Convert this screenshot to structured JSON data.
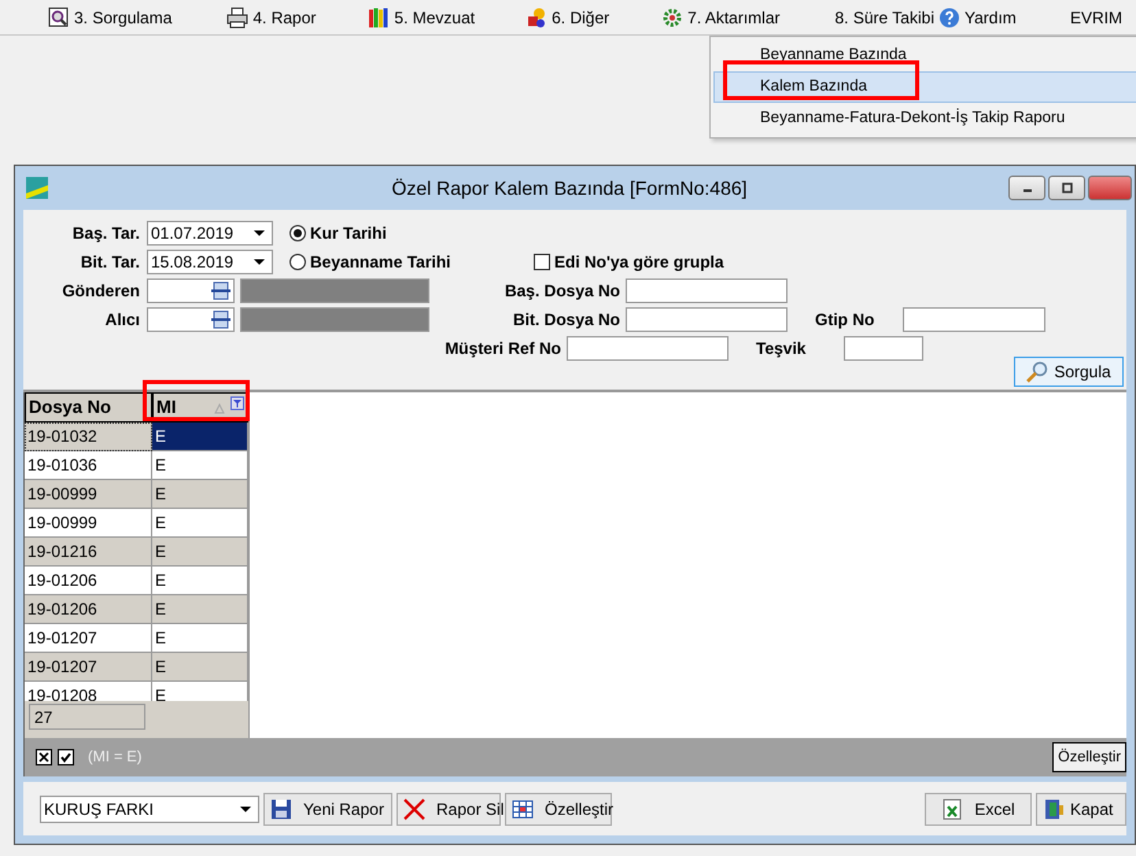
{
  "menu_bar": {
    "items": [
      {
        "label": "3.  Sorgulama"
      },
      {
        "label": "4.  Rapor"
      },
      {
        "label": "5.  Mevzuat"
      },
      {
        "label": "6.  Diğer"
      },
      {
        "label": "7.  Aktarımlar"
      },
      {
        "label": "8. Süre Takibi"
      },
      {
        "label": "Yardım"
      }
    ],
    "user": "EVRIM"
  },
  "dropdown_menu": {
    "items": [
      {
        "label": "Beyanname Bazında",
        "selected": false
      },
      {
        "label": "Kalem Bazında",
        "selected": true
      },
      {
        "label": "Beyanname-Fatura-Dekont-İş Takip Raporu",
        "selected": false
      }
    ]
  },
  "window": {
    "title": "Özel Rapor Kalem Bazında [FormNo:486]"
  },
  "form": {
    "start_date": {
      "label": "Baş. Tar.",
      "value": "01.07.2019"
    },
    "end_date": {
      "label": "Bit. Tar.",
      "value": "15.08.2019"
    },
    "date_type": [
      {
        "label": "Kur Tarihi",
        "selected": true
      },
      {
        "label": "Beyanname Tarihi",
        "selected": false
      }
    ],
    "group_by_edi": {
      "label": "Edi No'ya göre grupla",
      "checked": false
    },
    "sender": {
      "label": "Gönderen"
    },
    "receiver": {
      "label": "Alıcı"
    },
    "start_file_no": {
      "label": "Baş. Dosya No"
    },
    "end_file_no": {
      "label": "Bit. Dosya No"
    },
    "customer_ref_no": {
      "label": "Müşteri Ref No"
    },
    "gtip_no": {
      "label": "Gtip No"
    },
    "incentive": {
      "label": "Teşvik"
    },
    "query_button": "Sorgula"
  },
  "grid": {
    "columns": [
      "Dosya No",
      "MI"
    ],
    "rows": [
      {
        "cells": [
          "19-01032",
          "E"
        ],
        "selected": true
      },
      {
        "cells": [
          "19-01036",
          "E"
        ],
        "selected": false
      },
      {
        "cells": [
          "19-00999",
          "E"
        ],
        "selected": false
      },
      {
        "cells": [
          "19-00999",
          "E"
        ],
        "selected": false
      },
      {
        "cells": [
          "19-01216",
          "E"
        ],
        "selected": false
      },
      {
        "cells": [
          "19-01206",
          "E"
        ],
        "selected": false
      },
      {
        "cells": [
          "19-01206",
          "E"
        ],
        "selected": false
      },
      {
        "cells": [
          "19-01207",
          "E"
        ],
        "selected": false
      },
      {
        "cells": [
          "19-01207",
          "E"
        ],
        "selected": false
      },
      {
        "cells": [
          "19-01208",
          "E"
        ],
        "selected": false
      }
    ],
    "footer_count": "27"
  },
  "filter_bar": {
    "enabled": true,
    "filter": "(MI = E)",
    "customize_button": "Özelleştir"
  },
  "toolbar": {
    "report_select": "KURUŞ FARKI",
    "buttons": [
      {
        "label": "Yeni Rapor"
      },
      {
        "label": "Rapor Sil"
      },
      {
        "label": "Özelleştir"
      }
    ],
    "right_buttons": [
      {
        "label": "Excel"
      },
      {
        "label": "Kapat"
      }
    ]
  }
}
